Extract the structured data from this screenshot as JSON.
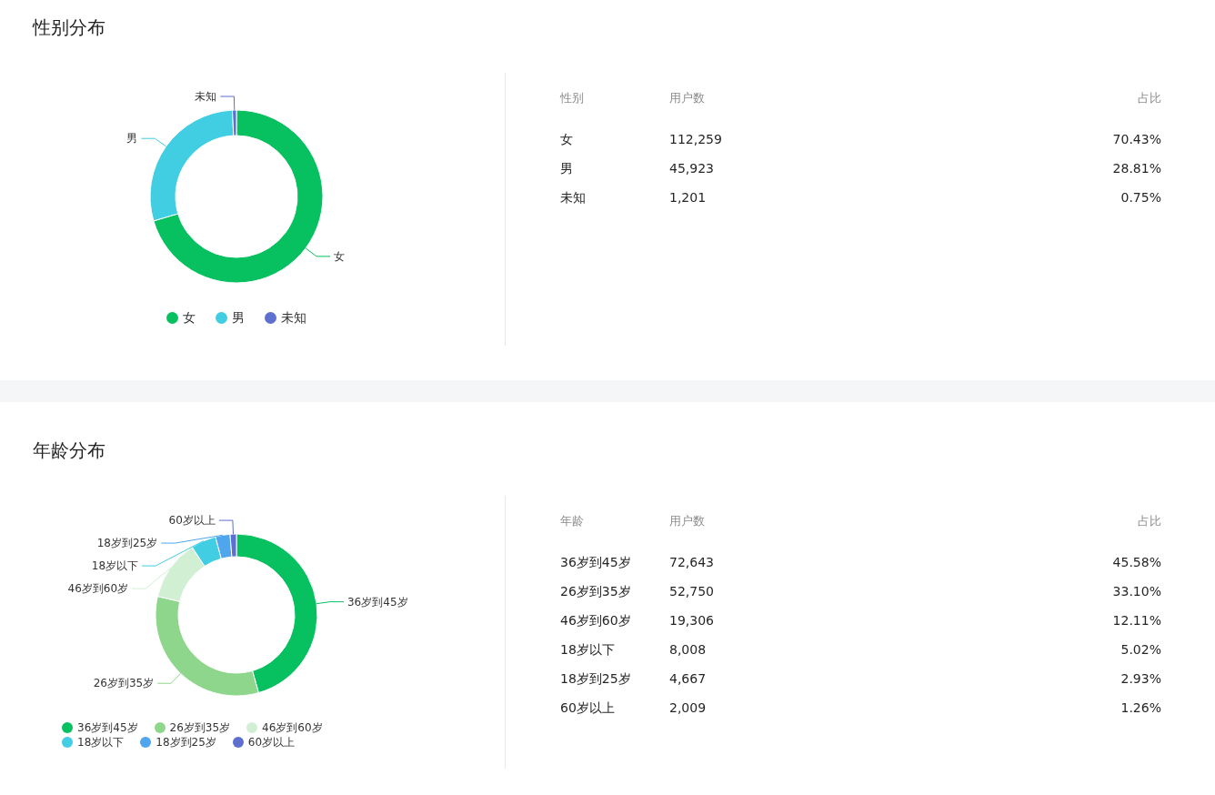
{
  "sections": [
    {
      "title": "性别分布",
      "chart_data": {
        "type": "donut",
        "categories": [
          "女",
          "男",
          "未知"
        ],
        "values": [
          70.43,
          28.81,
          0.75
        ]
      },
      "legend": [
        {
          "label": "女",
          "color": "#07c160"
        },
        {
          "label": "男",
          "color": "#41cde2"
        },
        {
          "label": "未知",
          "color": "#5d6fcf"
        }
      ],
      "table": {
        "columns": [
          "性别",
          "用户数",
          "占比"
        ],
        "rows": [
          [
            "女",
            "112,259",
            "70.43%"
          ],
          [
            "男",
            "45,923",
            "28.81%"
          ],
          [
            "未知",
            "1,201",
            "0.75%"
          ]
        ]
      }
    },
    {
      "title": "年龄分布",
      "chart_data": {
        "type": "donut",
        "categories": [
          "36岁到45岁",
          "26岁到35岁",
          "46岁到60岁",
          "18岁以下",
          "18岁到25岁",
          "60岁以上"
        ],
        "values": [
          45.58,
          33.1,
          12.11,
          5.02,
          2.93,
          1.26
        ]
      },
      "legend": [
        {
          "label": "36岁到45岁",
          "color": "#07c160"
        },
        {
          "label": "26岁到35岁",
          "color": "#8fd68d"
        },
        {
          "label": "46岁到60岁",
          "color": "#d0efd3"
        },
        {
          "label": "18岁以下",
          "color": "#41cde2"
        },
        {
          "label": "18岁到25岁",
          "color": "#4fa6ec"
        },
        {
          "label": "60岁以上",
          "color": "#5d6fcf"
        }
      ],
      "table": {
        "columns": [
          "年龄",
          "用户数",
          "占比"
        ],
        "rows": [
          [
            "36岁到45岁",
            "72,643",
            "45.58%"
          ],
          [
            "26岁到35岁",
            "52,750",
            "33.10%"
          ],
          [
            "46岁到60岁",
            "19,306",
            "12.11%"
          ],
          [
            "18岁以下",
            "8,008",
            "5.02%"
          ],
          [
            "18岁到25岁",
            "4,667",
            "2.93%"
          ],
          [
            "60岁以上",
            "2,009",
            "1.26%"
          ]
        ]
      }
    }
  ]
}
